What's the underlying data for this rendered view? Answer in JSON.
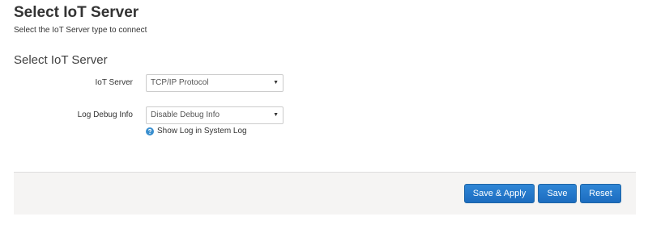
{
  "header": {
    "title": "Select IoT Server",
    "description": "Select the IoT Server type to connect"
  },
  "section": {
    "title": "Select IoT Server",
    "fields": {
      "iot_server": {
        "label": "IoT Server",
        "selected": "TCP/IP Protocol"
      },
      "log_debug": {
        "label": "Log Debug Info",
        "selected": "Disable Debug Info",
        "help_text": "Show Log in System Log"
      }
    }
  },
  "footer": {
    "save_apply_label": "Save & Apply",
    "save_label": "Save",
    "reset_label": "Reset"
  },
  "icons": {
    "select_arrow": "triangle-down-icon",
    "help": "question-circle-icon"
  },
  "colors": {
    "button_blue": "#2f86d6",
    "help_icon": "#3a8fcf",
    "footer_bg": "#f5f4f3"
  }
}
